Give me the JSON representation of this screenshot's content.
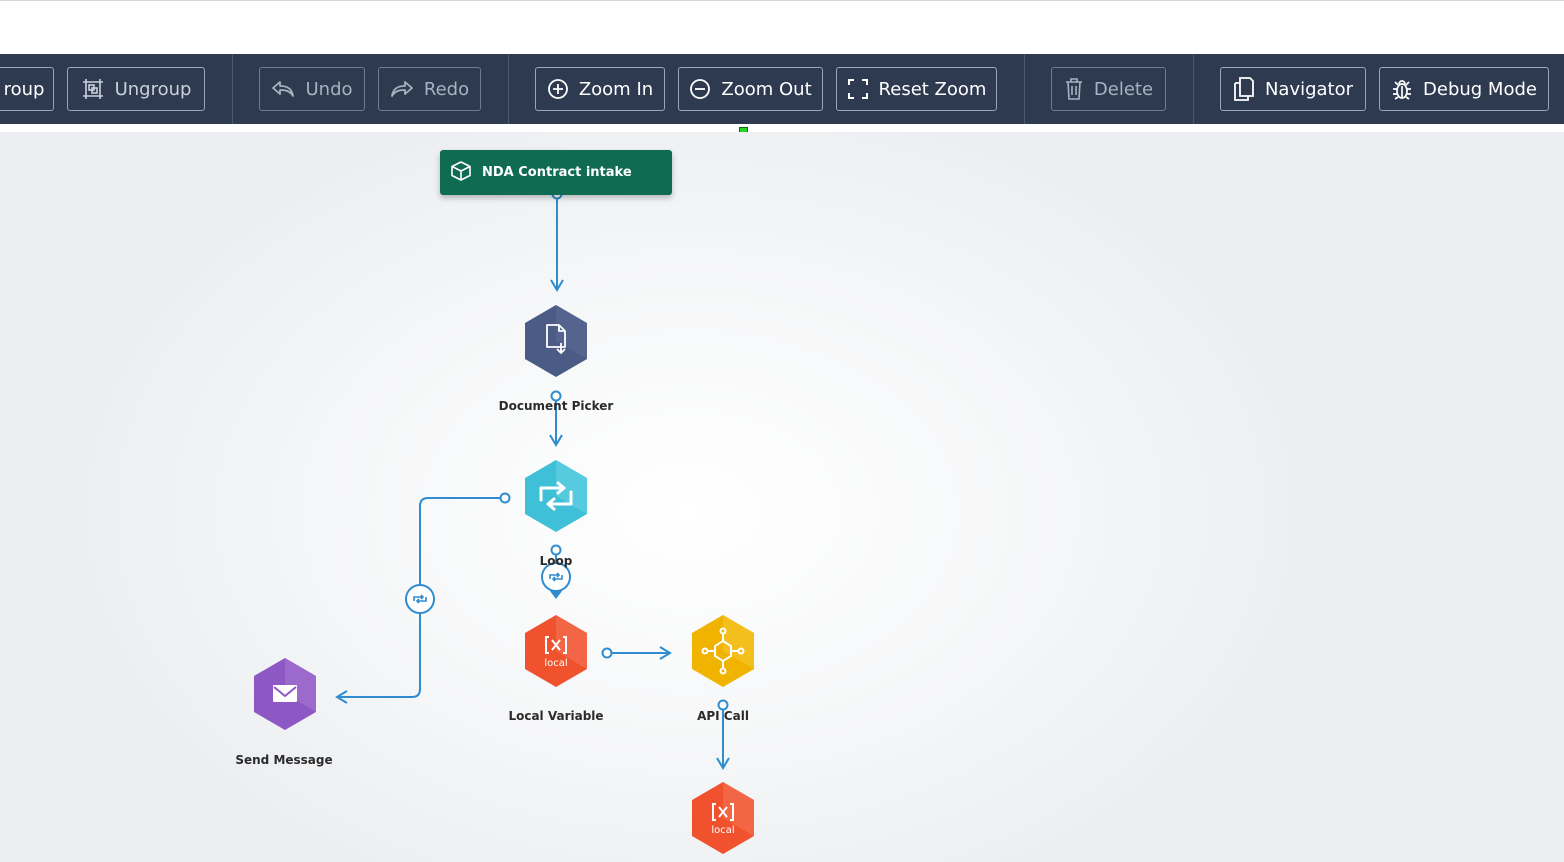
{
  "toolbar": {
    "group_label": "roup",
    "ungroup_label": "Ungroup",
    "undo_label": "Undo",
    "redo_label": "Redo",
    "zoom_in_label": "Zoom In",
    "zoom_out_label": "Zoom Out",
    "reset_zoom_label": "Reset Zoom",
    "delete_label": "Delete",
    "navigator_label": "Navigator",
    "debug_mode_label": "Debug Mode"
  },
  "flow": {
    "start_node": {
      "label": "NDA Contract intake",
      "icon": "cube-icon",
      "color": "#0f6b52"
    },
    "nodes": {
      "document_picker": {
        "label": "Document Picker",
        "icon": "document-picker-icon",
        "color": "#4a5b85"
      },
      "loop": {
        "label": "Loop",
        "icon": "loop-icon",
        "color": "#3fc0d8"
      },
      "local_variable": {
        "label": "Local Variable",
        "icon": "variable-icon",
        "badge": "local",
        "color": "#f0522e"
      },
      "api_call": {
        "label": "API Call",
        "icon": "api-icon",
        "color": "#f0b400"
      },
      "send_message": {
        "label": "Send Message",
        "icon": "envelope-icon",
        "color": "#8e58c4"
      },
      "local_variable_2": {
        "label": "",
        "icon": "variable-icon",
        "badge": "local",
        "color": "#f0522e"
      }
    },
    "connector_color": "#2e8ccf"
  }
}
